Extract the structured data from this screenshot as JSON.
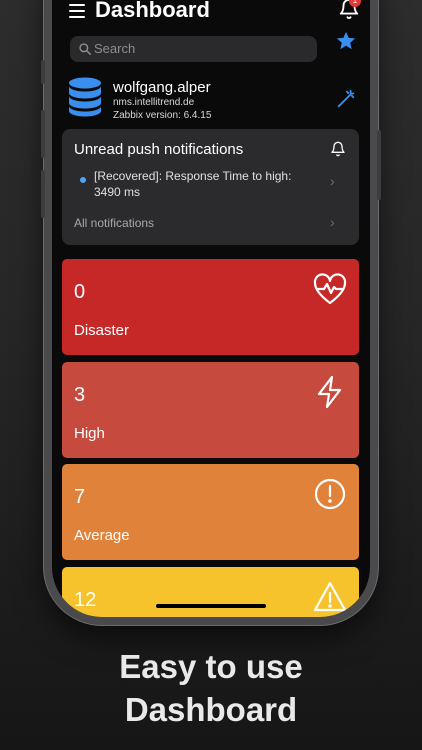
{
  "app": {
    "title": "Dashboard",
    "bell_badge": "1",
    "search_placeholder": "Search",
    "accent_color": "#3a8ef0"
  },
  "account": {
    "username": "wolfgang.alper",
    "host": "nms.intellitrend.de",
    "version": "Zabbix version: 6.4.15"
  },
  "notifications": {
    "title": "Unread push notifications",
    "items": [
      {
        "text": "[Recovered]: Response Time to high: 3490 ms"
      }
    ],
    "all_link": "All notifications"
  },
  "severity_cards": [
    {
      "count": "0",
      "label": "Disaster",
      "color": "#c62828",
      "icon": "heartbeat-icon"
    },
    {
      "count": "3",
      "label": "High",
      "color": "#c64a3d",
      "icon": "lightning-icon"
    },
    {
      "count": "7",
      "label": "Average",
      "color": "#e0823a",
      "icon": "exclamation-circle-icon"
    },
    {
      "count": "12",
      "label": "",
      "color": "#f7c32d",
      "icon": "warning-triangle-icon"
    }
  ],
  "caption": {
    "line1": "Easy to use",
    "line2": "Dashboard"
  }
}
